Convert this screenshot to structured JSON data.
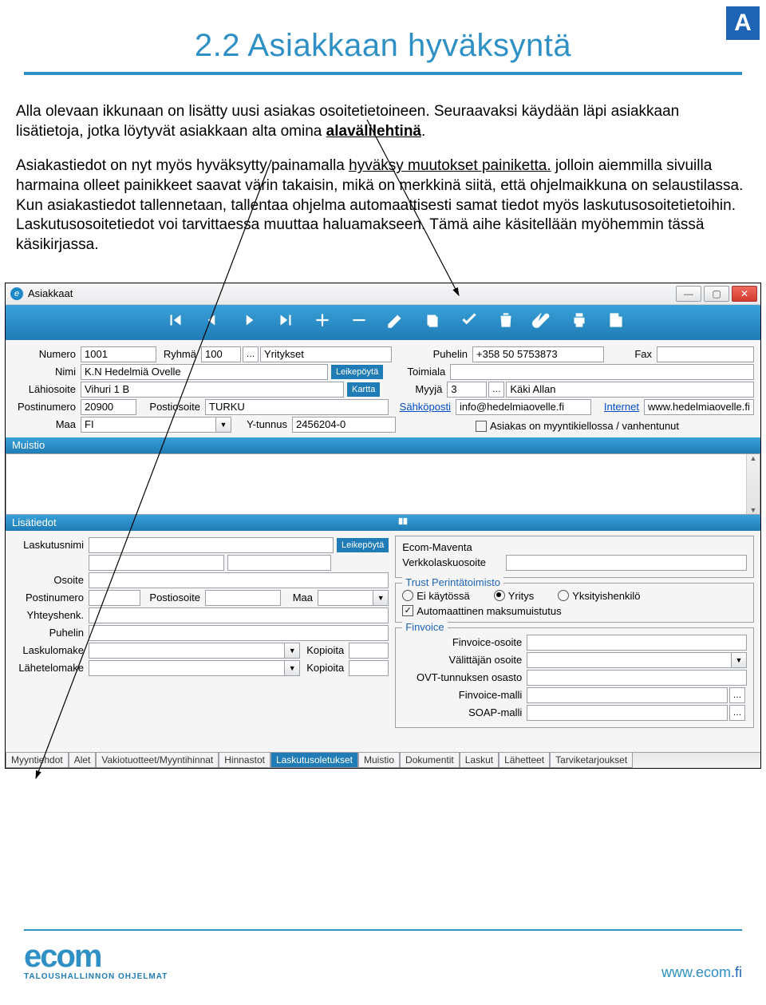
{
  "badge": "A",
  "title": "2.2 Asiakkaan hyväksyntä",
  "para1_a": "Alla olevaan ikkunaan on lisätty uusi asiakas osoitetietoineen. Seuraavaksi käydään läpi asiakkaan lisätietoja, jotka löytyvät asiakkaan alta omina ",
  "para1_b": "alavälilehtinä",
  "para1_c": ".",
  "para2_a": "Asiakastiedot on nyt myös hyväksytty painamalla ",
  "para2_b": "hyväksy muutokset painiketta.",
  "para2_c": " jolloin aiemmilla sivuilla harmaina olleet painikkeet saavat värin takaisin, mikä on merkkinä siitä, että ohjelmaikkuna on selaustilassa. Kun asiakastiedot tallennetaan, tallentaa ohjelma automaattisesti samat tiedot myös laskutusosoitetietoihin. Laskutusosoitetiedot voi tarvittaessa muuttaa haluamakseen. Tämä aihe käsitellään myöhemmin tässä käsikirjassa.",
  "window": {
    "title": "Asiakkaat",
    "toolbar_icons": [
      "first",
      "prev",
      "next",
      "last",
      "add",
      "remove",
      "edit",
      "copy",
      "confirm",
      "delete",
      "attach",
      "print",
      "export"
    ],
    "fields": {
      "numero_lbl": "Numero",
      "numero": "1001",
      "ryhma_lbl": "Ryhmä",
      "ryhma": "100",
      "ryhma_txt": "Yritykset",
      "puhelin_lbl": "Puhelin",
      "puhelin": "+358 50 5753873",
      "fax_lbl": "Fax",
      "fax": "",
      "nimi_lbl": "Nimi",
      "nimi": "K.N Hedelmiä Ovelle",
      "leikepoyta": "Leikepöytä",
      "toimiala_lbl": "Toimiala",
      "toimiala": "",
      "lahiosoite_lbl": "Lähiosoite",
      "lahiosoite": "Vihuri 1 B",
      "kartta": "Kartta",
      "myyja_lbl": "Myyjä",
      "myyja_n": "3",
      "myyja_txt": "Käki Allan",
      "postinumero_lbl": "Postinumero",
      "postinumero": "20900",
      "postiosoite_lbl": "Postiosoite",
      "postiosoite": "TURKU",
      "sahkoposti_lbl": "Sähköposti",
      "sahkoposti": "info@hedelmiaovelle.fi",
      "internet_lbl": "Internet",
      "internet": "www.hedelmiaovelle.fi",
      "maa_lbl": "Maa",
      "maa": "FI",
      "ytunnus_lbl": "Y-tunnus",
      "ytunnus": "2456204-0",
      "kielto": "Asiakas on myyntikiellossa / vanhentunut"
    },
    "muistio": "Muistio",
    "lisatiedot": "Lisätiedot",
    "billing": {
      "laskutusnimi_lbl": "Laskutusnimi",
      "osoite_lbl": "Osoite",
      "postinumero_lbl": "Postinumero",
      "postiosoite_lbl": "Postiosoite",
      "maa_lbl": "Maa",
      "yhteyshenk_lbl": "Yhteyshenk.",
      "puhelin_lbl": "Puhelin",
      "laskulomake_lbl": "Laskulomake",
      "kopioita1": "Kopioita",
      "lahetelomake_lbl": "Lähetelomake",
      "kopioita2": "Kopioita"
    },
    "right": {
      "maventa1": "Ecom-Maventa",
      "maventa2": "Verkkolaskuosoite",
      "trust_title": "Trust Perintätoimisto",
      "r1": "Ei käytössä",
      "r2": "Yritys",
      "r3": "Yksityishenkilö",
      "automuistutus": "Automaattinen maksumuistutus",
      "finvoice_title": "Finvoice",
      "finvoice_osoite": "Finvoice-osoite",
      "valittaja": "Välittäjän osoite",
      "ovt": "OVT-tunnuksen osasto",
      "finvoice_malli": "Finvoice-malli",
      "soap": "SOAP-malli"
    },
    "tabs": [
      "Myyntiehdot",
      "Alet",
      "Vakiotuotteet/Myyntihinnat",
      "Hinnastot",
      "Laskutusoletukset",
      "Muistio",
      "Dokumentit",
      "Laskut",
      "Lähetteet",
      "Tarviketarjoukset"
    ],
    "active_tab": 4
  },
  "footer": {
    "logo": "ecom",
    "sub": "TALOUSHALLINNON OHJELMAT",
    "url_a": "www.ecom",
    "url_b": ".fi"
  }
}
